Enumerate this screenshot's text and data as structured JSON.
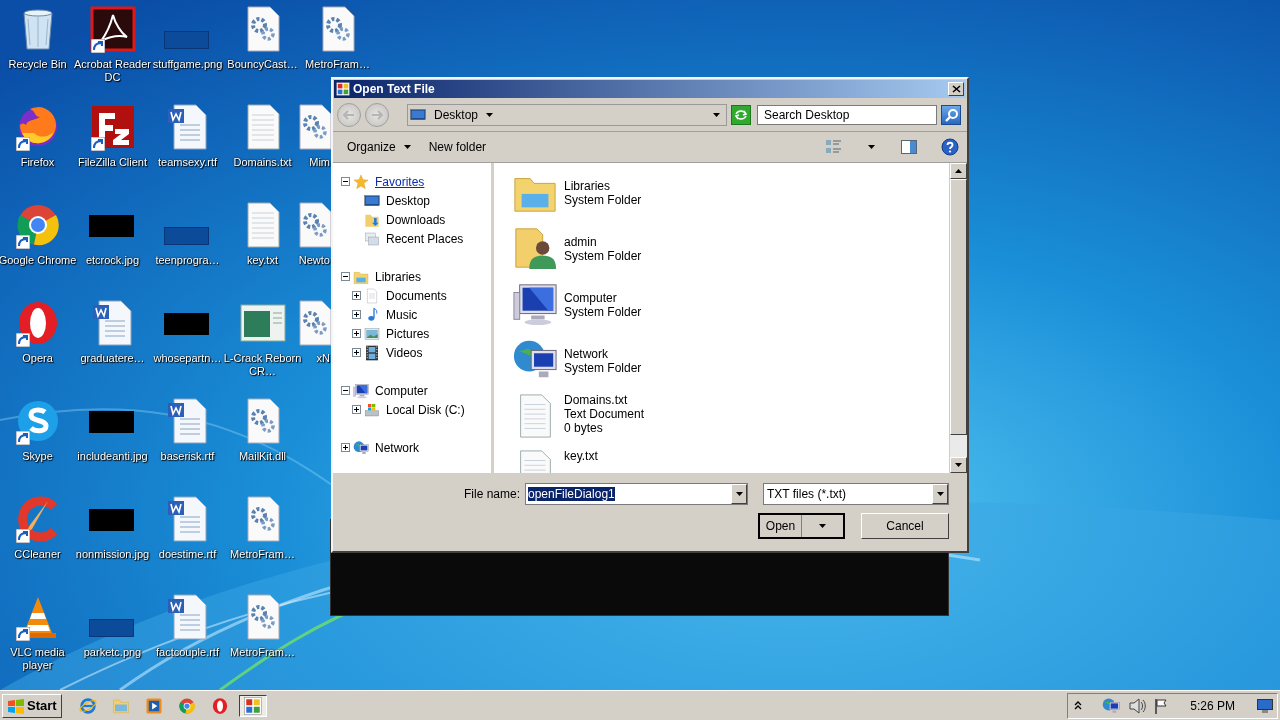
{
  "desktop_icons": [
    {
      "label": "Recycle Bin",
      "kind": "recycle",
      "shortcut": false
    },
    {
      "label": "Firefox",
      "kind": "firefox",
      "shortcut": true
    },
    {
      "label": "Google Chrome",
      "kind": "chrome",
      "shortcut": true
    },
    {
      "label": "Opera",
      "kind": "opera",
      "shortcut": true
    },
    {
      "label": "Skype",
      "kind": "skype",
      "shortcut": true
    },
    {
      "label": "CCleaner",
      "kind": "ccleaner",
      "shortcut": true
    },
    {
      "label": "VLC media player",
      "kind": "vlc",
      "shortcut": true
    },
    {
      "label": "Acrobat Reader DC",
      "kind": "pdf",
      "shortcut": true
    },
    {
      "label": "FileZilla Client",
      "kind": "filezilla",
      "shortcut": true
    },
    {
      "label": "etcrock.jpg",
      "kind": "black-thumb",
      "shortcut": false
    },
    {
      "label": "graduatere…",
      "kind": "word",
      "shortcut": false
    },
    {
      "label": "includeanti.jpg",
      "kind": "black-thumb",
      "shortcut": false
    },
    {
      "label": "nonmission.jpg",
      "kind": "black-thumb",
      "shortcut": false
    },
    {
      "label": "parketc.png",
      "kind": "dark-thumb",
      "shortcut": false
    },
    {
      "label": "stuffgame.png",
      "kind": "dark-thumb",
      "shortcut": false
    },
    {
      "label": "teamsexy.rtf",
      "kind": "word",
      "shortcut": false
    },
    {
      "label": "teenprogra…",
      "kind": "dark-thumb",
      "shortcut": false
    },
    {
      "label": "whosepartn…",
      "kind": "black-thumb",
      "shortcut": false
    },
    {
      "label": "baserisk.rtf",
      "kind": "word",
      "shortcut": false
    },
    {
      "label": "doestime.rtf",
      "kind": "word",
      "shortcut": false
    },
    {
      "label": "factcouple.rtf",
      "kind": "word",
      "shortcut": false
    },
    {
      "label": "BouncyCast…",
      "kind": "dll",
      "shortcut": false
    },
    {
      "label": "Domains.txt",
      "kind": "text",
      "shortcut": false
    },
    {
      "label": "key.txt",
      "kind": "text",
      "shortcut": false
    },
    {
      "label": "L-Crack Reborn CR…",
      "kind": "window",
      "shortcut": false
    },
    {
      "label": "MailKit.dll",
      "kind": "dll",
      "shortcut": false
    },
    {
      "label": "MetroFram…",
      "kind": "dll",
      "shortcut": false
    },
    {
      "label": "MetroFram…",
      "kind": "dll",
      "shortcut": false
    },
    {
      "label": "MetroFram…",
      "kind": "dll",
      "shortcut": false
    },
    {
      "label": "Mim",
      "kind": "dll",
      "shortcut": false
    },
    {
      "label": "Newto",
      "kind": "dll",
      "shortcut": false
    },
    {
      "label": "xN",
      "kind": "dll",
      "shortcut": false
    }
  ],
  "dialog": {
    "title": "Open Text File",
    "nav_buttons": [
      {
        "kind": "back",
        "disabled": true
      },
      {
        "kind": "forward",
        "disabled": true
      }
    ],
    "address": "Desktop",
    "search": {
      "placeholder": "Search Desktop"
    },
    "toolbar": [
      {
        "label": "Organize",
        "kind": "menu"
      },
      {
        "label": "New folder",
        "kind": "button"
      }
    ],
    "nav_tree": [
      {
        "label": "Favorites",
        "kind": "star",
        "expanded": true,
        "hot": true,
        "children": [
          {
            "label": "Desktop",
            "kind": "desktop"
          },
          {
            "label": "Downloads",
            "kind": "downloads"
          },
          {
            "label": "Recent Places",
            "kind": "recent"
          }
        ]
      },
      {
        "label": "Libraries",
        "kind": "libraries",
        "expanded": true,
        "hot": false,
        "children": [
          {
            "label": "Documents",
            "kind": "documents",
            "expanded": false
          },
          {
            "label": "Music",
            "kind": "music",
            "expanded": false
          },
          {
            "label": "Pictures",
            "kind": "pictures",
            "expanded": false
          },
          {
            "label": "Videos",
            "kind": "videos",
            "expanded": false
          }
        ]
      },
      {
        "label": "Computer",
        "kind": "computer",
        "expanded": true,
        "hot": false,
        "children": [
          {
            "label": "Local Disk (C:)",
            "kind": "disk",
            "expanded": false
          }
        ]
      },
      {
        "label": "Network",
        "kind": "network",
        "expanded": false,
        "hot": false
      }
    ],
    "files": [
      {
        "name": "Libraries",
        "kind": "libraries",
        "details": [
          "System Folder"
        ]
      },
      {
        "name": "admin",
        "kind": "user",
        "details": [
          "System Folder"
        ]
      },
      {
        "name": "Computer",
        "kind": "computer",
        "details": [
          "System Folder"
        ]
      },
      {
        "name": "Network",
        "kind": "network",
        "details": [
          "System Folder"
        ]
      },
      {
        "name": "Domains.txt",
        "kind": "text",
        "details": [
          "Text Document",
          "0 bytes"
        ]
      },
      {
        "name": "key.txt",
        "kind": "text"
      }
    ],
    "file_name": {
      "label": "File name:",
      "value": "openFileDialog1",
      "value_selected": true
    },
    "file_type": "TXT files (*.txt)",
    "buttons": [
      {
        "label": "Open",
        "kind": "split"
      },
      {
        "label": "Cancel",
        "kind": "plain"
      }
    ]
  },
  "taskbar": {
    "start": "Start",
    "apps": [
      {
        "kind": "ie",
        "active": false
      },
      {
        "kind": "folder",
        "active": false
      },
      {
        "kind": "media",
        "active": false
      },
      {
        "kind": "chrome",
        "active": false
      },
      {
        "kind": "opera",
        "active": false
      },
      {
        "kind": "dialog",
        "active": true
      }
    ],
    "clock": "5:26 PM"
  }
}
